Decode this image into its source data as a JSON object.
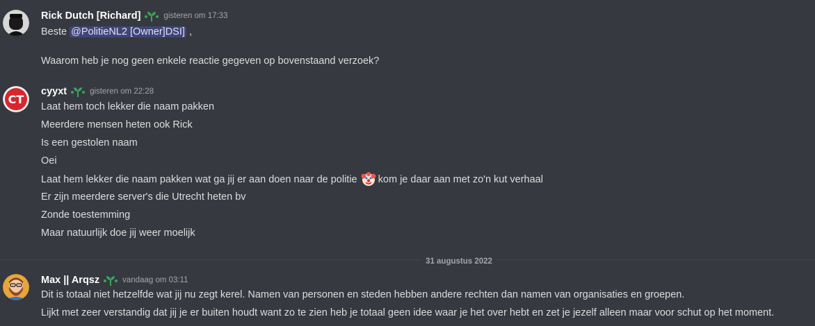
{
  "messages": [
    {
      "username": "Rick Dutch [Richard]",
      "timestamp": "gisteren om 17:33",
      "lines": {
        "l1_prefix": "Beste ",
        "l1_mention": "@PolitieNL2 [Owner]DSI]",
        "l1_suffix": " ,",
        "l2": "Waarom heb je nog geen enkele reactie gegeven op bovenstaand verzoek?"
      }
    },
    {
      "username": "cyyxt",
      "avatar_text": "CT",
      "timestamp": "gisteren om 22:28",
      "lines": {
        "l1": "Laat hem toch lekker die naam pakken",
        "l2": "Meerdere mensen heten ook Rick",
        "l3": "Is een gestolen naam",
        "l4": "Oei",
        "l5_prefix": "Laat hem lekker die naam pakken wat ga jij er aan doen naar de politie",
        "l5_suffix": "kom je daar aan met zo'n kut verhaal",
        "l6": "Er zijn meerdere server's die Utrecht heten bv",
        "l7": "Zonde toestemming",
        "l8": "Maar natuurlijk doe jij weer moelijk"
      }
    },
    {
      "username": "Max || Arqsz",
      "timestamp": "vandaag om 03:11",
      "lines": {
        "l1": "Dit is totaal niet hetzelfde wat jij nu zegt kerel. Namen van personen en steden hebben andere rechten dan namen van organisaties en groepen.",
        "l2": "Lijkt met zeer verstandig dat jij je er buiten houdt want zo te zien heb je totaal geen idee waar je het over hebt en zet je jezelf alleen maar voor schut op het moment."
      }
    }
  ],
  "date_divider": "31 augustus 2022",
  "icons": {
    "badge": "sprout-badge-icon",
    "emoji": "clown-face-emoji"
  },
  "colors": {
    "background": "#36393f",
    "username": "#ffffff",
    "text": "#dcddde",
    "timestamp": "#a3a6aa",
    "mention_bg": "#5865f24d",
    "badge": "#3ba55c"
  }
}
